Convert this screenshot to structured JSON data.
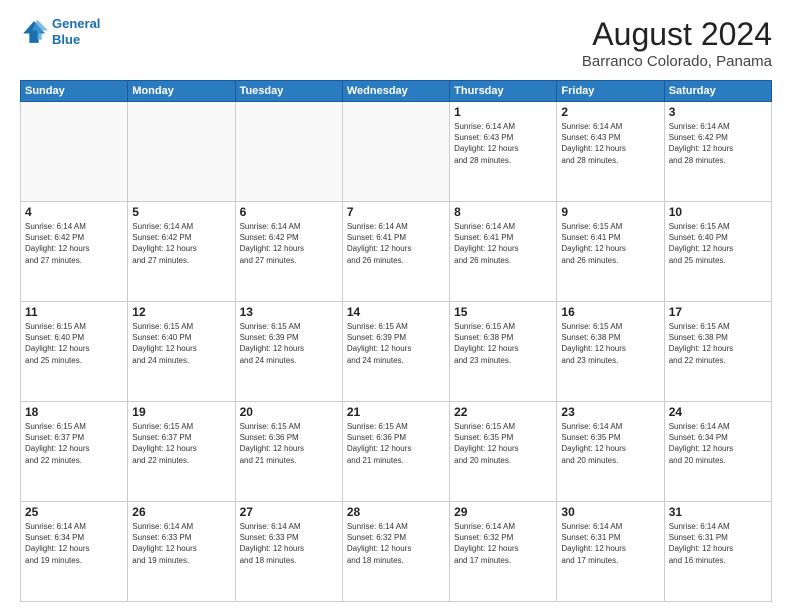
{
  "header": {
    "logo_line1": "General",
    "logo_line2": "Blue",
    "title": "August 2024",
    "subtitle": "Barranco Colorado, Panama"
  },
  "days_of_week": [
    "Sunday",
    "Monday",
    "Tuesday",
    "Wednesday",
    "Thursday",
    "Friday",
    "Saturday"
  ],
  "weeks": [
    [
      {
        "day": "",
        "info": ""
      },
      {
        "day": "",
        "info": ""
      },
      {
        "day": "",
        "info": ""
      },
      {
        "day": "",
        "info": ""
      },
      {
        "day": "1",
        "info": "Sunrise: 6:14 AM\nSunset: 6:43 PM\nDaylight: 12 hours\nand 28 minutes."
      },
      {
        "day": "2",
        "info": "Sunrise: 6:14 AM\nSunset: 6:43 PM\nDaylight: 12 hours\nand 28 minutes."
      },
      {
        "day": "3",
        "info": "Sunrise: 6:14 AM\nSunset: 6:42 PM\nDaylight: 12 hours\nand 28 minutes."
      }
    ],
    [
      {
        "day": "4",
        "info": "Sunrise: 6:14 AM\nSunset: 6:42 PM\nDaylight: 12 hours\nand 27 minutes."
      },
      {
        "day": "5",
        "info": "Sunrise: 6:14 AM\nSunset: 6:42 PM\nDaylight: 12 hours\nand 27 minutes."
      },
      {
        "day": "6",
        "info": "Sunrise: 6:14 AM\nSunset: 6:42 PM\nDaylight: 12 hours\nand 27 minutes."
      },
      {
        "day": "7",
        "info": "Sunrise: 6:14 AM\nSunset: 6:41 PM\nDaylight: 12 hours\nand 26 minutes."
      },
      {
        "day": "8",
        "info": "Sunrise: 6:14 AM\nSunset: 6:41 PM\nDaylight: 12 hours\nand 26 minutes."
      },
      {
        "day": "9",
        "info": "Sunrise: 6:15 AM\nSunset: 6:41 PM\nDaylight: 12 hours\nand 26 minutes."
      },
      {
        "day": "10",
        "info": "Sunrise: 6:15 AM\nSunset: 6:40 PM\nDaylight: 12 hours\nand 25 minutes."
      }
    ],
    [
      {
        "day": "11",
        "info": "Sunrise: 6:15 AM\nSunset: 6:40 PM\nDaylight: 12 hours\nand 25 minutes."
      },
      {
        "day": "12",
        "info": "Sunrise: 6:15 AM\nSunset: 6:40 PM\nDaylight: 12 hours\nand 24 minutes."
      },
      {
        "day": "13",
        "info": "Sunrise: 6:15 AM\nSunset: 6:39 PM\nDaylight: 12 hours\nand 24 minutes."
      },
      {
        "day": "14",
        "info": "Sunrise: 6:15 AM\nSunset: 6:39 PM\nDaylight: 12 hours\nand 24 minutes."
      },
      {
        "day": "15",
        "info": "Sunrise: 6:15 AM\nSunset: 6:38 PM\nDaylight: 12 hours\nand 23 minutes."
      },
      {
        "day": "16",
        "info": "Sunrise: 6:15 AM\nSunset: 6:38 PM\nDaylight: 12 hours\nand 23 minutes."
      },
      {
        "day": "17",
        "info": "Sunrise: 6:15 AM\nSunset: 6:38 PM\nDaylight: 12 hours\nand 22 minutes."
      }
    ],
    [
      {
        "day": "18",
        "info": "Sunrise: 6:15 AM\nSunset: 6:37 PM\nDaylight: 12 hours\nand 22 minutes."
      },
      {
        "day": "19",
        "info": "Sunrise: 6:15 AM\nSunset: 6:37 PM\nDaylight: 12 hours\nand 22 minutes."
      },
      {
        "day": "20",
        "info": "Sunrise: 6:15 AM\nSunset: 6:36 PM\nDaylight: 12 hours\nand 21 minutes."
      },
      {
        "day": "21",
        "info": "Sunrise: 6:15 AM\nSunset: 6:36 PM\nDaylight: 12 hours\nand 21 minutes."
      },
      {
        "day": "22",
        "info": "Sunrise: 6:15 AM\nSunset: 6:35 PM\nDaylight: 12 hours\nand 20 minutes."
      },
      {
        "day": "23",
        "info": "Sunrise: 6:14 AM\nSunset: 6:35 PM\nDaylight: 12 hours\nand 20 minutes."
      },
      {
        "day": "24",
        "info": "Sunrise: 6:14 AM\nSunset: 6:34 PM\nDaylight: 12 hours\nand 20 minutes."
      }
    ],
    [
      {
        "day": "25",
        "info": "Sunrise: 6:14 AM\nSunset: 6:34 PM\nDaylight: 12 hours\nand 19 minutes."
      },
      {
        "day": "26",
        "info": "Sunrise: 6:14 AM\nSunset: 6:33 PM\nDaylight: 12 hours\nand 19 minutes."
      },
      {
        "day": "27",
        "info": "Sunrise: 6:14 AM\nSunset: 6:33 PM\nDaylight: 12 hours\nand 18 minutes."
      },
      {
        "day": "28",
        "info": "Sunrise: 6:14 AM\nSunset: 6:32 PM\nDaylight: 12 hours\nand 18 minutes."
      },
      {
        "day": "29",
        "info": "Sunrise: 6:14 AM\nSunset: 6:32 PM\nDaylight: 12 hours\nand 17 minutes."
      },
      {
        "day": "30",
        "info": "Sunrise: 6:14 AM\nSunset: 6:31 PM\nDaylight: 12 hours\nand 17 minutes."
      },
      {
        "day": "31",
        "info": "Sunrise: 6:14 AM\nSunset: 6:31 PM\nDaylight: 12 hours\nand 16 minutes."
      }
    ]
  ]
}
